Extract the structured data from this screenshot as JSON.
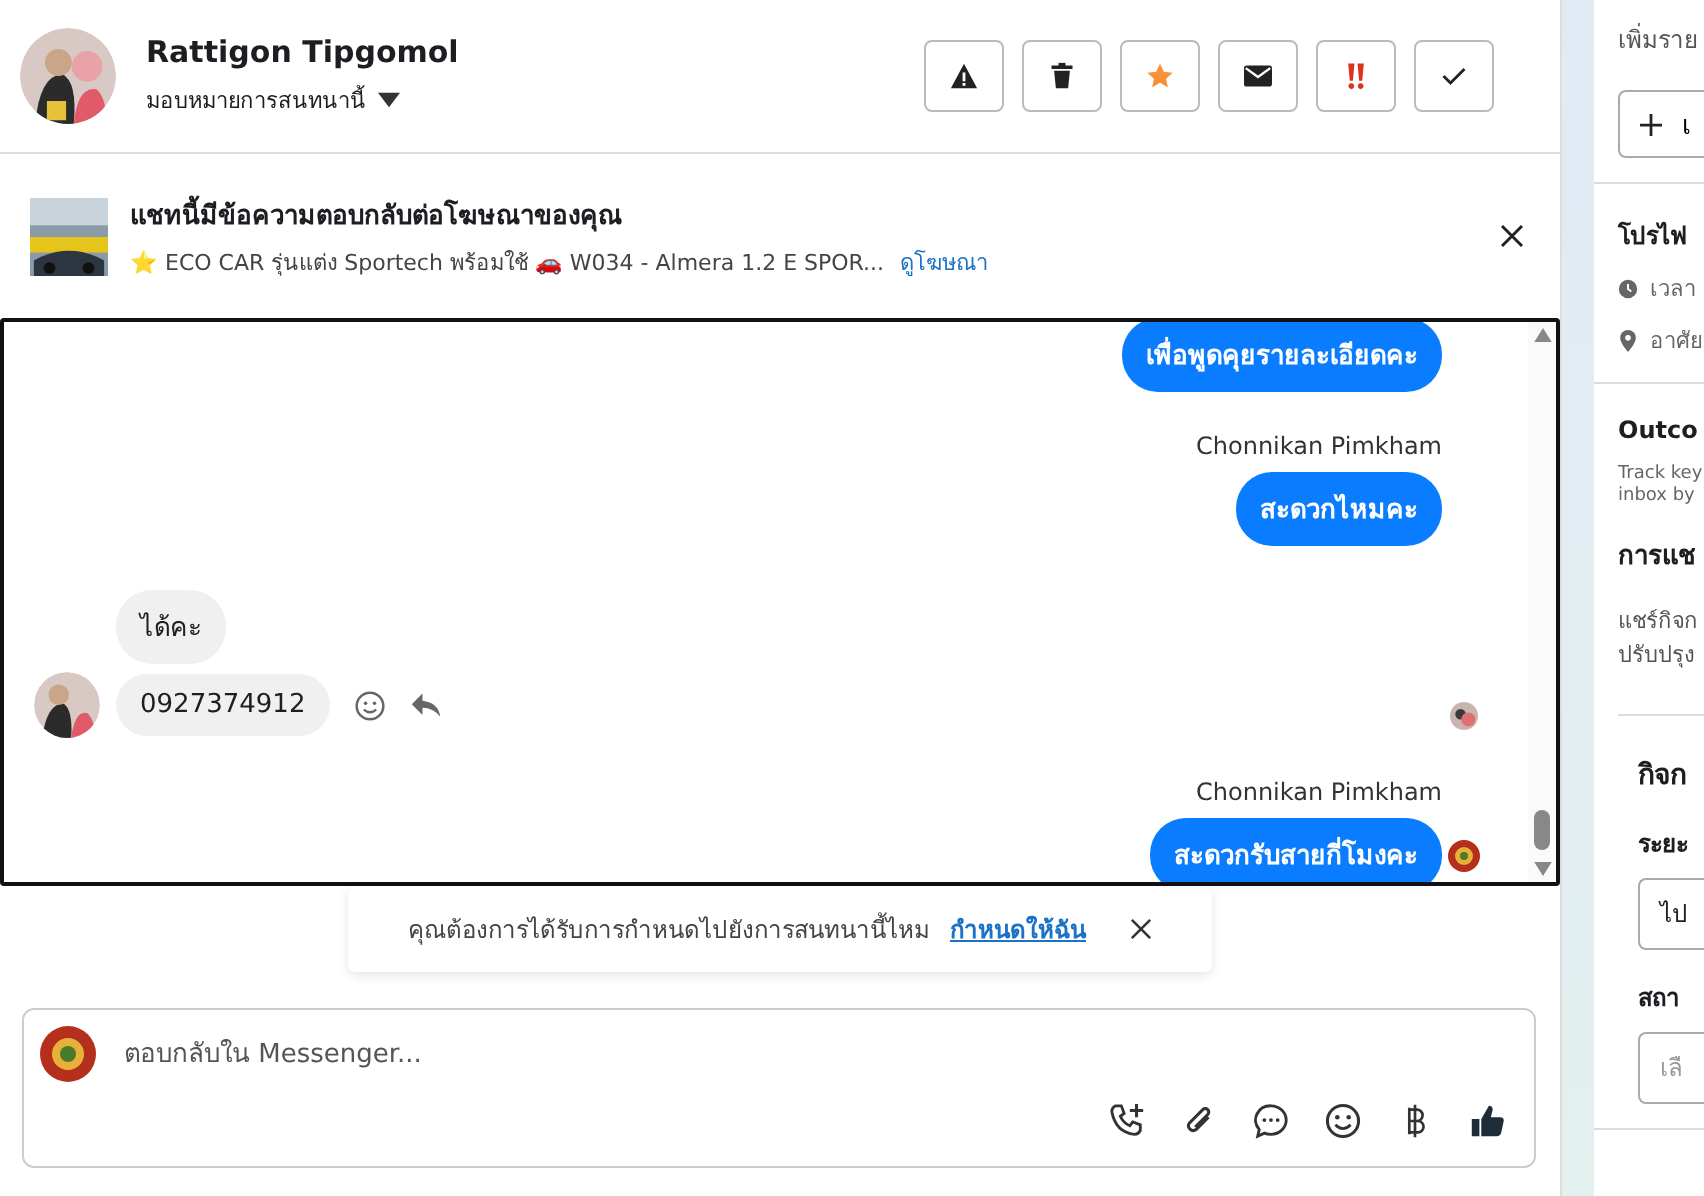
{
  "header": {
    "name": "Rattigon Tipgomol",
    "assign": "มอบหมายการสนทนานี้"
  },
  "ad_banner": {
    "title": "แชทนี้มีข้อความตอบกลับต่อโฆษณาของคุณ",
    "ad_text": "⭐ ECO CAR รุ่นแต่ง Sportech พร้อมใช้ 🚗 W034 - Almera 1.2 E SPOR...",
    "link": "ดูโฆษณา"
  },
  "messages": [
    {
      "kind": "outgoing",
      "text": "เพื่อพูดคุยรายละเอียดคะ"
    },
    {
      "kind": "sender",
      "text": "Chonnikan Pimkham"
    },
    {
      "kind": "outgoing",
      "text": "สะดวกไหมคะ"
    },
    {
      "kind": "incoming",
      "text": "ได้คะ"
    },
    {
      "kind": "incoming_last",
      "text": "0927374912"
    },
    {
      "kind": "sender",
      "text": "Chonnikan Pimkham"
    },
    {
      "kind": "outgoing_last",
      "text": "สะดวกรับสายกี่โมงคะ"
    }
  ],
  "reminder": {
    "text": "คุณต้องการได้รับการกำหนดไปยังการสนทนานี้ไหม",
    "link": "กำหนดให้ฉัน"
  },
  "composer": {
    "placeholder": "ตอบกลับใน Messenger..."
  },
  "side_panel": {
    "add_label": "เพิ่มราย",
    "add_button": "เ",
    "profile_title": "โปรไฟ",
    "time_label": "เวลา",
    "location_label": "อาศัย",
    "outcome_title": "Outco",
    "outcome_text": [
      "Track key",
      "inbox by"
    ],
    "share_title": "การแช",
    "share_text": [
      "แชร์กิจก",
      "ปรับปรุง"
    ],
    "activity_title": "กิจก",
    "period_label": "ระยะ",
    "period_value": "ไป",
    "status_label": "สถา",
    "status_value": "เลื"
  }
}
